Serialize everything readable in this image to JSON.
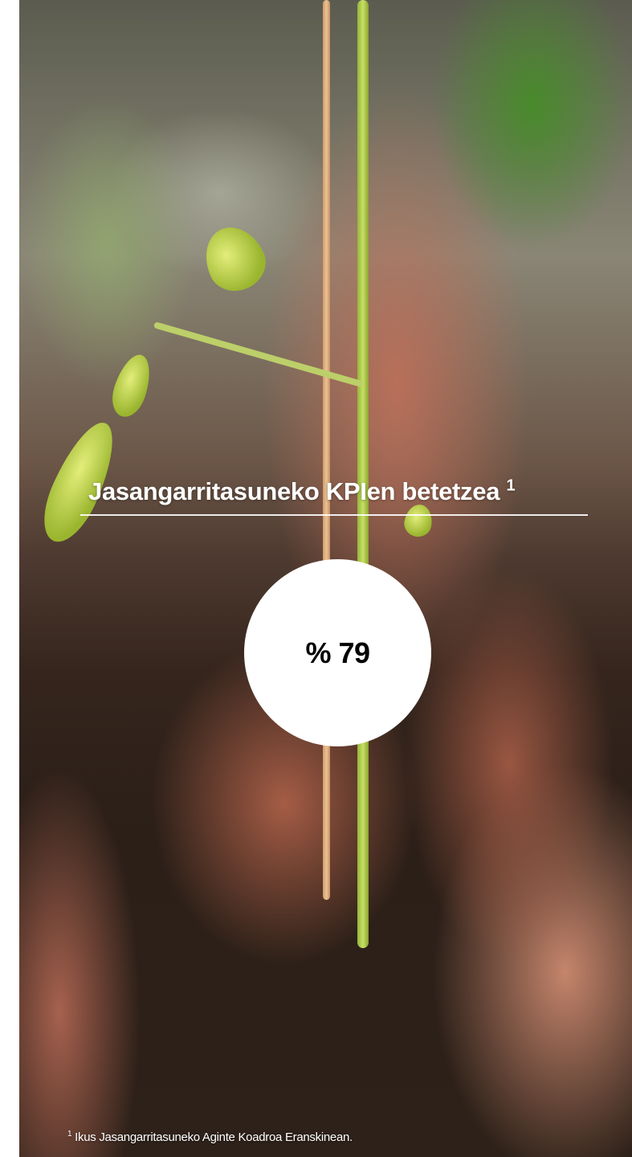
{
  "headline": {
    "text": "Jasangarritasuneko KPIen betetzea",
    "footnote_marker": "1"
  },
  "kpi": {
    "value": "% 79"
  },
  "footnote": {
    "marker": "1",
    "text": "Ikus Jasangarritasuneko Aginte Koadroa Eranskinean."
  },
  "colors": {
    "text": "#ffffff",
    "circle": "#ffffff",
    "kpi_text": "#000000"
  }
}
